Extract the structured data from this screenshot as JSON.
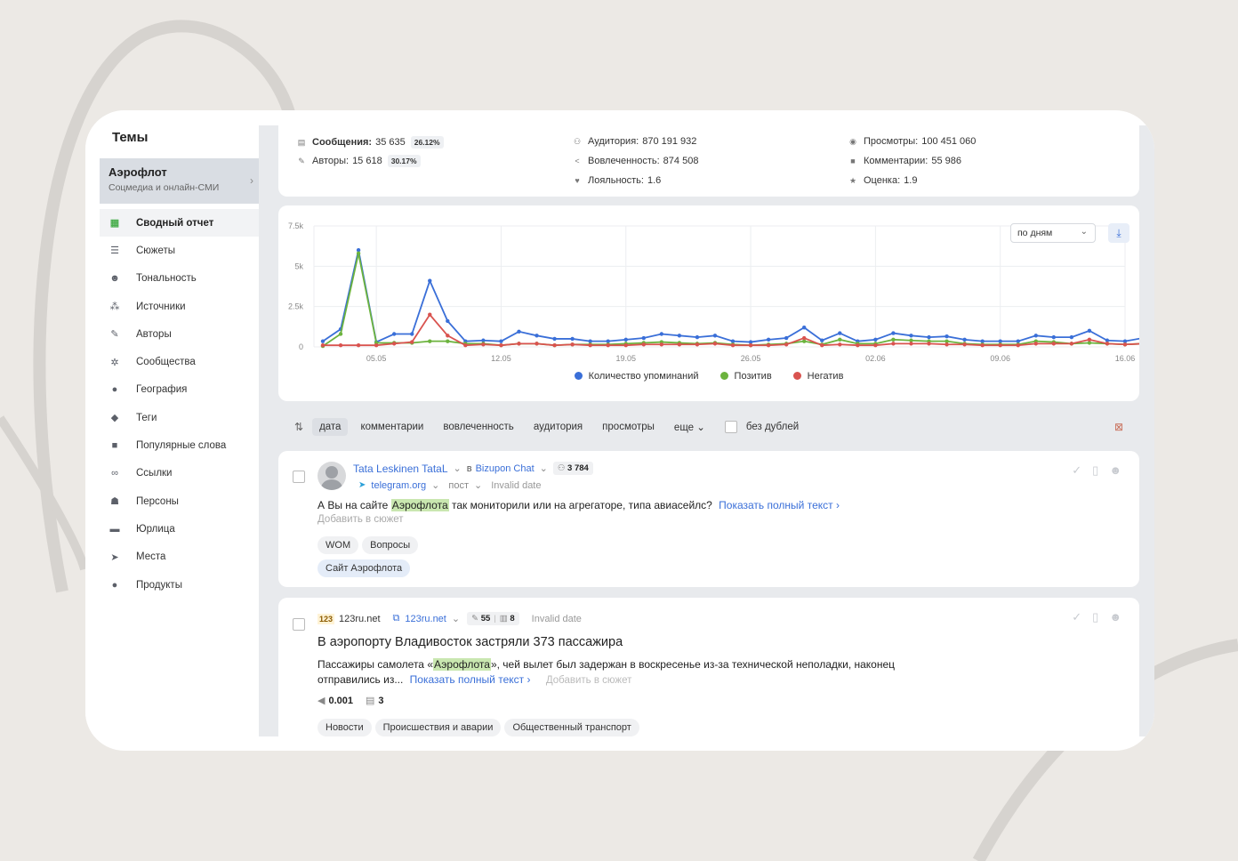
{
  "sidebar": {
    "title": "Темы",
    "theme": {
      "name": "Аэрофлот",
      "subtitle": "Соцмедиа и онлайн-СМИ"
    },
    "items": [
      {
        "label": "Сводный отчет",
        "icon": "grid-icon",
        "glyph": "▦"
      },
      {
        "label": "Сюжеты",
        "icon": "list-icon",
        "glyph": "☰"
      },
      {
        "label": "Тональность",
        "icon": "smile-icon",
        "glyph": "☻"
      },
      {
        "label": "Источники",
        "icon": "nodes-icon",
        "glyph": "⁂"
      },
      {
        "label": "Авторы",
        "icon": "pen-icon",
        "glyph": "✎"
      },
      {
        "label": "Сообщества",
        "icon": "network-icon",
        "glyph": "✲"
      },
      {
        "label": "География",
        "icon": "pin-icon",
        "glyph": "●"
      },
      {
        "label": "Теги",
        "icon": "tag-icon",
        "glyph": "◆"
      },
      {
        "label": "Популярные слова",
        "icon": "chat-icon",
        "glyph": "■"
      },
      {
        "label": "Ссылки",
        "icon": "link-icon",
        "glyph": "∞"
      },
      {
        "label": "Персоны",
        "icon": "person-icon",
        "glyph": "☗"
      },
      {
        "label": "Юрлица",
        "icon": "briefcase-icon",
        "glyph": "▬"
      },
      {
        "label": "Места",
        "icon": "navigation-icon",
        "glyph": "➤"
      },
      {
        "label": "Продукты",
        "icon": "apple-icon",
        "glyph": "●"
      }
    ]
  },
  "stats": {
    "messages": {
      "label": "Сообщения:",
      "value": "35 635",
      "badge": "26.12%"
    },
    "authors": {
      "label": "Авторы:",
      "value": "15 618",
      "badge": "30.17%"
    },
    "audience": {
      "label": "Аудитория:",
      "value": "870 191 932"
    },
    "engagement": {
      "label": "Вовлеченность:",
      "value": "874 508"
    },
    "loyalty": {
      "label": "Лояльность:",
      "value": "1.6"
    },
    "views": {
      "label": "Просмотры:",
      "value": "100 451 060"
    },
    "comments": {
      "label": "Комментарии:",
      "value": "55 986"
    },
    "rating": {
      "label": "Оценка:",
      "value": "1.9"
    }
  },
  "chart_controls": {
    "period": "по дням"
  },
  "chart_data": {
    "type": "line",
    "x": [
      "02.05",
      "03.05",
      "04.05",
      "05.05",
      "06.05",
      "07.05",
      "08.05",
      "09.05",
      "10.05",
      "11.05",
      "12.05",
      "13.05",
      "14.05",
      "15.05",
      "16.05",
      "17.05",
      "18.05",
      "19.05",
      "20.05",
      "21.05",
      "22.05",
      "23.05",
      "24.05",
      "25.05",
      "26.05",
      "27.05",
      "28.05",
      "29.05",
      "30.05",
      "31.05",
      "01.06",
      "02.06",
      "03.06",
      "04.06",
      "05.06",
      "06.06",
      "07.06",
      "08.06",
      "09.06",
      "10.06",
      "11.06",
      "12.06",
      "13.06",
      "14.06",
      "15.06",
      "16.06"
    ],
    "x_ticks": [
      "05.05",
      "12.05",
      "19.05",
      "26.05",
      "02.06",
      "09.06",
      "16.06"
    ],
    "y_ticks": [
      "0",
      "2.5k",
      "5k",
      "7.5k"
    ],
    "ylim": [
      0,
      7500
    ],
    "grid": true,
    "legend_position": "bottom",
    "series": [
      {
        "name": "Количество упоминаний",
        "color": "#3a6fd8",
        "values": [
          350,
          1100,
          6000,
          300,
          800,
          800,
          4100,
          1600,
          350,
          400,
          350,
          950,
          700,
          500,
          500,
          350,
          350,
          450,
          550,
          800,
          700,
          600,
          700,
          350,
          300,
          450,
          550,
          1200,
          400,
          850,
          350,
          450,
          850,
          700,
          600,
          650,
          450,
          350,
          350,
          350,
          700,
          600,
          600,
          1000,
          400,
          350,
          550
        ]
      },
      {
        "name": "Позитив",
        "color": "#6cb33e",
        "values": [
          50,
          800,
          5800,
          250,
          250,
          250,
          350,
          350,
          200,
          200,
          100,
          200,
          200,
          100,
          150,
          150,
          150,
          200,
          250,
          300,
          250,
          200,
          250,
          150,
          100,
          150,
          200,
          350,
          150,
          450,
          200,
          200,
          450,
          400,
          350,
          350,
          200,
          150,
          150,
          150,
          350,
          300,
          200,
          250,
          200,
          150,
          200
        ]
      },
      {
        "name": "Негатив",
        "color": "#d9534f",
        "values": [
          100,
          100,
          100,
          100,
          200,
          300,
          2000,
          700,
          100,
          150,
          100,
          200,
          200,
          100,
          150,
          100,
          100,
          100,
          150,
          150,
          150,
          150,
          200,
          100,
          100,
          100,
          150,
          550,
          100,
          150,
          100,
          100,
          200,
          200,
          200,
          150,
          150,
          100,
          100,
          100,
          200,
          200,
          200,
          450,
          200,
          150,
          200
        ]
      }
    ]
  },
  "sortbar": {
    "items": [
      "дата",
      "комментарии",
      "вовлеченность",
      "аудитория",
      "просмотры",
      "еще"
    ],
    "nodup": "без дублей"
  },
  "post1": {
    "author": "Tata Leskinen TataL",
    "in": "в",
    "source": "Bizupon Chat",
    "audience": "3 784",
    "platform": "telegram.org",
    "kind": "пост",
    "date": "Invalid date",
    "text_before": "А Вы на сайте ",
    "text_hl": "Аэрофлота",
    "text_after": " так мониторили или на агрегаторе, типа авиасейлс?",
    "show_full": "Показать полный текст ›",
    "add_story": "Добавить в сюжет",
    "tags": [
      "WOM",
      "Вопросы"
    ],
    "story_tags": [
      "Сайт Аэрофлота"
    ]
  },
  "post2": {
    "site_name": "123ru.net",
    "site_link": "123ru.net",
    "reach": "55",
    "bars": "8",
    "date": "Invalid date",
    "title": "В аэропорту Владивосток застряли 373 пассажира",
    "line1_before": "Пассажиры самолета «",
    "line1_hl": "Аэрофлота",
    "line1_after": "», чей вылет был задержан в воскресенье из-за технической неполадки, наконец",
    "line2": "отправились из...",
    "show_full": "Показать полный текст ›",
    "add_story": "Добавить в сюжет",
    "metric1": "0.001",
    "metric2": "3",
    "tags": [
      "Новости",
      "Происшествия и аварии",
      "Общественный транспорт"
    ]
  }
}
